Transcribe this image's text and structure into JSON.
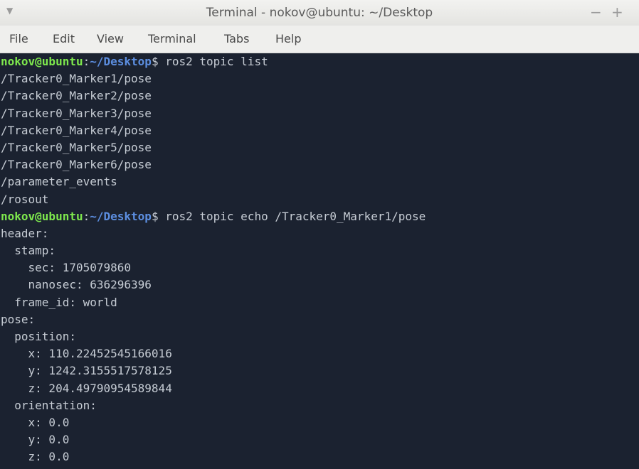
{
  "window": {
    "title": "Terminal - nokov@ubuntu: ~/Desktop",
    "menu_glyph": "▼",
    "minimize_glyph": "−",
    "maximize_glyph": "+"
  },
  "menubar": {
    "items": [
      "File",
      "Edit",
      "View",
      "Terminal",
      "Tabs",
      "Help"
    ]
  },
  "terminal": {
    "prompt": {
      "user_host": "nokov@ubuntu",
      "colon": ":",
      "path": "~/Desktop",
      "dollar": "$"
    },
    "lines": [
      {
        "type": "prompt",
        "command": " ros2 topic list"
      },
      {
        "type": "output",
        "text": "/Tracker0_Marker1/pose"
      },
      {
        "type": "output",
        "text": "/Tracker0_Marker2/pose"
      },
      {
        "type": "output",
        "text": "/Tracker0_Marker3/pose"
      },
      {
        "type": "output",
        "text": "/Tracker0_Marker4/pose"
      },
      {
        "type": "output",
        "text": "/Tracker0_Marker5/pose"
      },
      {
        "type": "output",
        "text": "/Tracker0_Marker6/pose"
      },
      {
        "type": "output",
        "text": "/parameter_events"
      },
      {
        "type": "output",
        "text": "/rosout"
      },
      {
        "type": "prompt",
        "command": " ros2 topic echo /Tracker0_Marker1/pose"
      },
      {
        "type": "output",
        "text": "header:"
      },
      {
        "type": "output",
        "text": "  stamp:"
      },
      {
        "type": "output",
        "text": "    sec: 1705079860"
      },
      {
        "type": "output",
        "text": "    nanosec: 636296396"
      },
      {
        "type": "output",
        "text": "  frame_id: world"
      },
      {
        "type": "output",
        "text": "pose:"
      },
      {
        "type": "output",
        "text": "  position:"
      },
      {
        "type": "output",
        "text": "    x: 110.22452545166016"
      },
      {
        "type": "output",
        "text": "    y: 1242.3155517578125"
      },
      {
        "type": "output",
        "text": "    z: 204.49790954589844"
      },
      {
        "type": "output",
        "text": "  orientation:"
      },
      {
        "type": "output",
        "text": "    x: 0.0"
      },
      {
        "type": "output",
        "text": "    y: 0.0"
      },
      {
        "type": "output",
        "text": "    z: 0.0"
      }
    ]
  }
}
